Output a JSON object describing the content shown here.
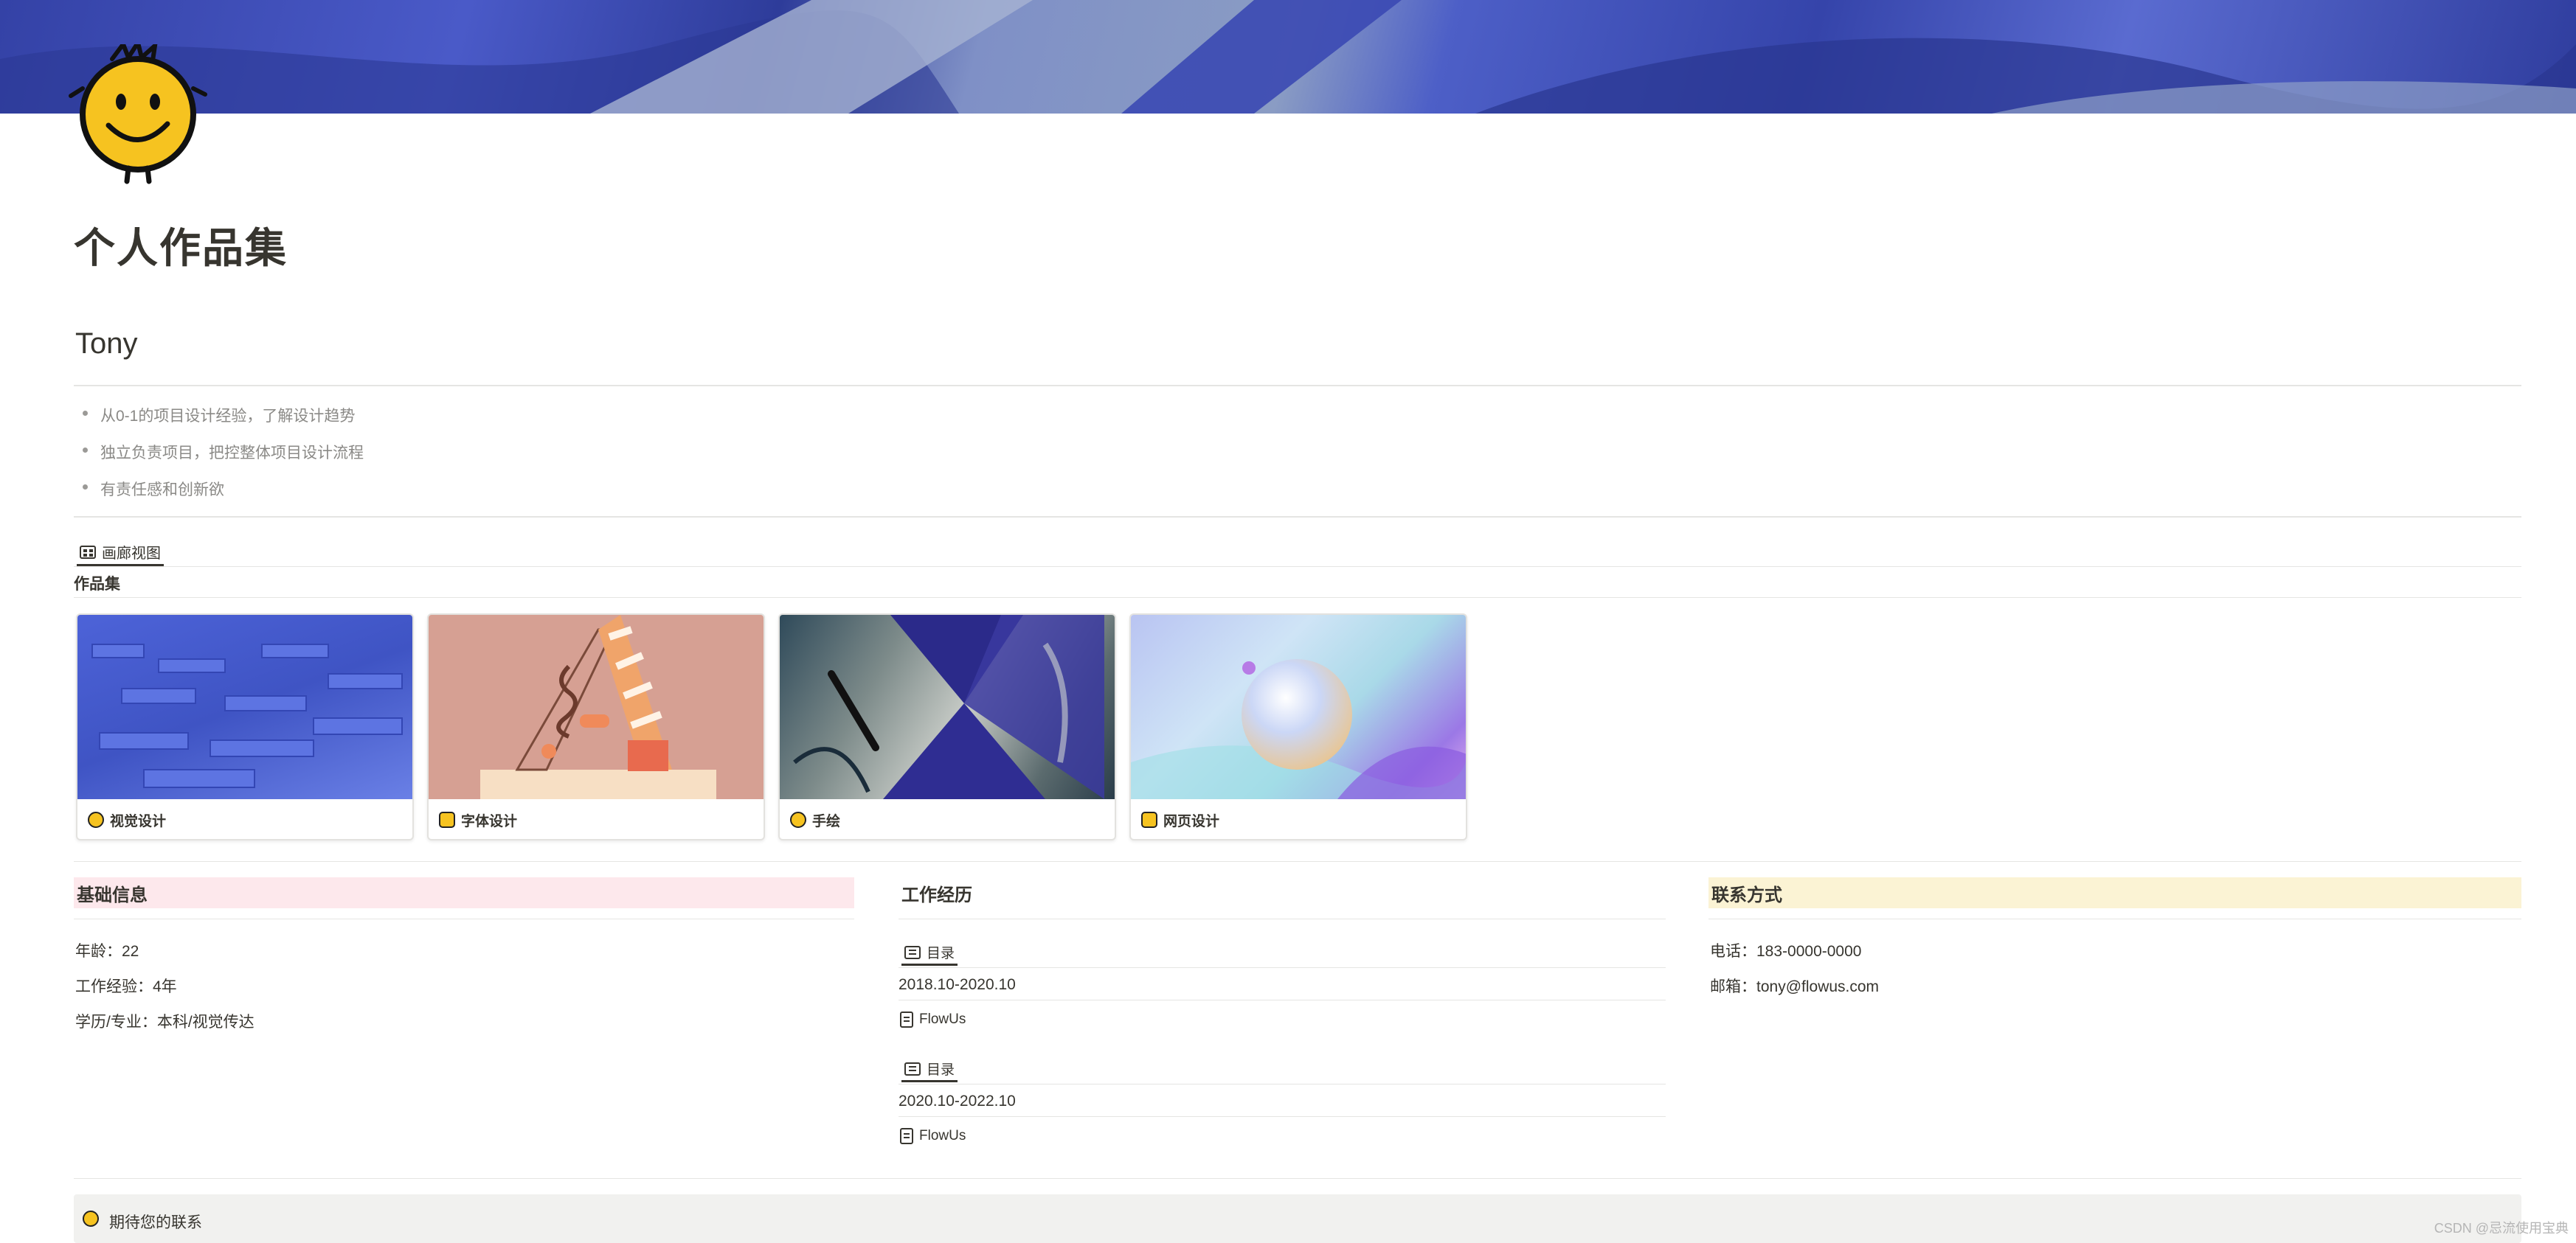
{
  "page": {
    "title": "个人作品集",
    "name": "Tony",
    "bullets": [
      "从0-1的项目设计经验，了解设计趋势",
      "独立负责项目，把控整体项目设计流程",
      "有责任感和创新欲"
    ]
  },
  "gallery": {
    "view_tab_label": "画廊视图",
    "title": "作品集",
    "cards": [
      {
        "label": "视觉设计",
        "icon": "emoji-icon"
      },
      {
        "label": "字体设计",
        "icon": "note-icon"
      },
      {
        "label": "手绘",
        "icon": "palette-icon"
      },
      {
        "label": "网页设计",
        "icon": "note-icon"
      }
    ]
  },
  "basic_info": {
    "heading": "基础信息",
    "lines": [
      "年龄：22",
      "工作经验：4年",
      "学历/专业：本科/视觉传达"
    ]
  },
  "work_history": {
    "heading": "工作经历",
    "entries": [
      {
        "tab": "目录",
        "period": "2018.10-2020.10",
        "company": "FlowUs"
      },
      {
        "tab": "目录",
        "period": "2020.10-2022.10",
        "company": "FlowUs"
      }
    ]
  },
  "contact": {
    "heading": "联系方式",
    "lines": [
      "电话：183-0000-0000",
      "邮箱：tony@flowus.com"
    ]
  },
  "footer": {
    "text": "期待您的联系"
  },
  "watermark": "CSDN @忌流使用宝典",
  "colors": {
    "pink_highlight": "#fde8ec",
    "yellow_highlight": "#fbf3d4",
    "accent_blue": "#3a4bbf"
  }
}
